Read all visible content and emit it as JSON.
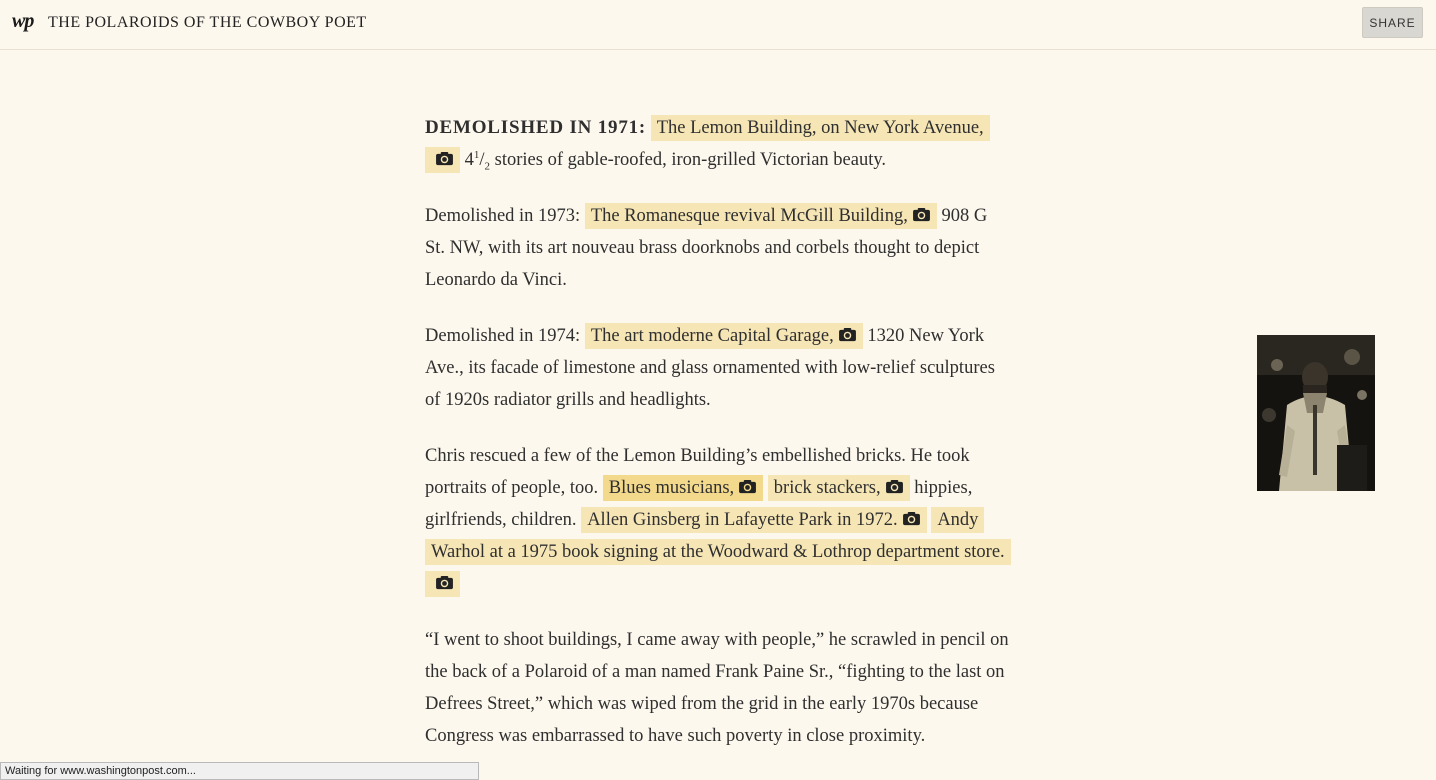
{
  "header": {
    "logo": "wp",
    "title": "THE POLAROIDS OF THE COWBOY POET",
    "share_label": "SHARE"
  },
  "article": {
    "p1": {
      "lead": "DEMOLISHED IN 1971:",
      "link": "The Lemon Building, on New York Avenue,",
      "frac_whole": "4",
      "frac_num": "1",
      "frac_den": "2",
      "tail": "stories of gable-roofed, iron-grilled Victorian beauty."
    },
    "p2": {
      "lead": "Demolished in 1973:",
      "link": "The Romanesque revival McGill Building,",
      "tail": "908 G St. NW, with its art nouveau brass doorknobs and corbels thought to depict Leonardo da Vinci."
    },
    "p3": {
      "lead": "Demolished in 1974:",
      "link": "The art moderne Capital Garage,",
      "tail": "1320 New York Ave., its facade of limestone and glass ornamented with low-relief sculptures of 1920s radiator grills and headlights."
    },
    "p4": {
      "text1": "Chris rescued a few of the Lemon Building’s embellished bricks. He took portraits of people, too.",
      "link1": "Blues musicians,",
      "link2": "brick stackers,",
      "text2": "hippies, girlfriends, children.",
      "link3": "Allen Ginsberg in Lafayette Park in 1972.",
      "link4": "Andy Warhol at a 1975 book signing at the Woodward & Lothrop department store."
    },
    "p5": {
      "text": "“I went to shoot buildings, I came away with people,” he scrawled in pencil on the back of a Polaroid of a man named Frank Paine Sr., “fighting to the last on Defrees Street,” which was wiped from the grid in the early 1970s because Congress was embarrassed to have such poverty in close proximity."
    }
  },
  "icons": {
    "camera": "camera-icon"
  },
  "status": {
    "text": "Waiting for www.washingtonpost.com..."
  },
  "colors": {
    "background": "#fdf8ee",
    "highlight": "#f6e6b6",
    "highlight_active": "#f3d98c"
  }
}
